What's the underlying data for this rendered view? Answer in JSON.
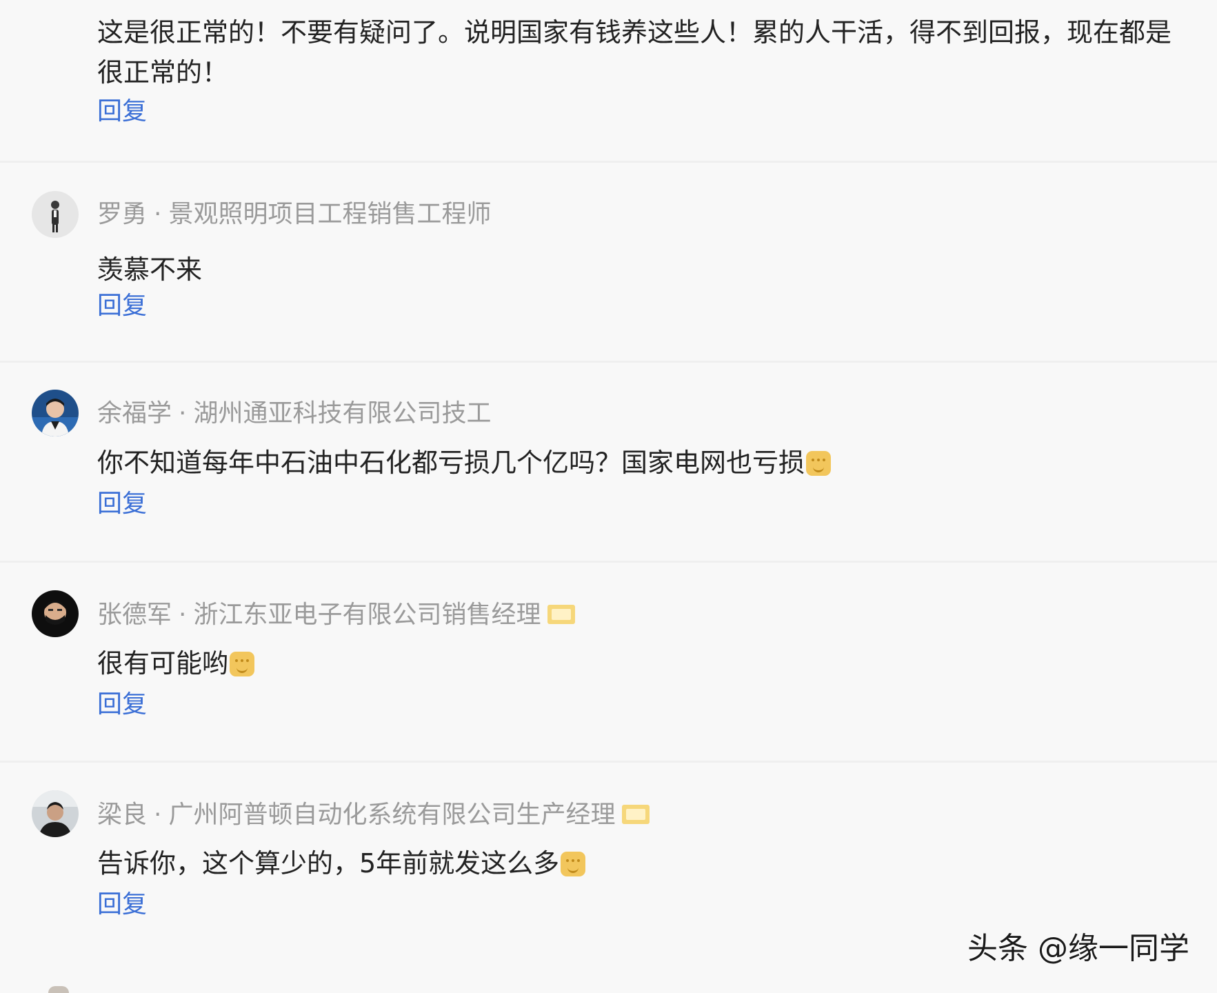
{
  "comments": [
    {
      "author": "",
      "title": "",
      "text": "这是很正常的！不要有疑问了。说明国家有钱养这些人！累的人干活，得不到回报，现在都是很正常的！",
      "reply_label": "回复",
      "badge": false,
      "emoji": false
    },
    {
      "author": "罗勇",
      "title": "景观照明项目工程销售工程师",
      "text": "羡慕不来",
      "reply_label": "回复",
      "badge": false,
      "emoji": false
    },
    {
      "author": "余福学",
      "title": "湖州通亚科技有限公司技工",
      "text": "你不知道每年中石油中石化都亏损几个亿吗？国家电网也亏损",
      "reply_label": "回复",
      "badge": false,
      "emoji": true
    },
    {
      "author": "张德军",
      "title": "浙江东亚电子有限公司销售经理",
      "text": "很有可能哟",
      "reply_label": "回复",
      "badge": true,
      "emoji": true
    },
    {
      "author": "梁良",
      "title": "广州阿普顿自动化系统有限公司生产经理",
      "text": "告诉你，这个算少的，5年前就发这么多",
      "reply_label": "回复",
      "badge": true,
      "emoji": true
    }
  ],
  "separator": "·",
  "watermark": "头条 @缘一同学",
  "icons": {
    "badge": "verified-badge-icon",
    "emoji": "laughing-emoji-icon"
  },
  "colors": {
    "background": "#f8f8f8",
    "meta_text": "#9a9a9a",
    "reply_link": "#3b6fd6",
    "body_text": "#222222"
  }
}
